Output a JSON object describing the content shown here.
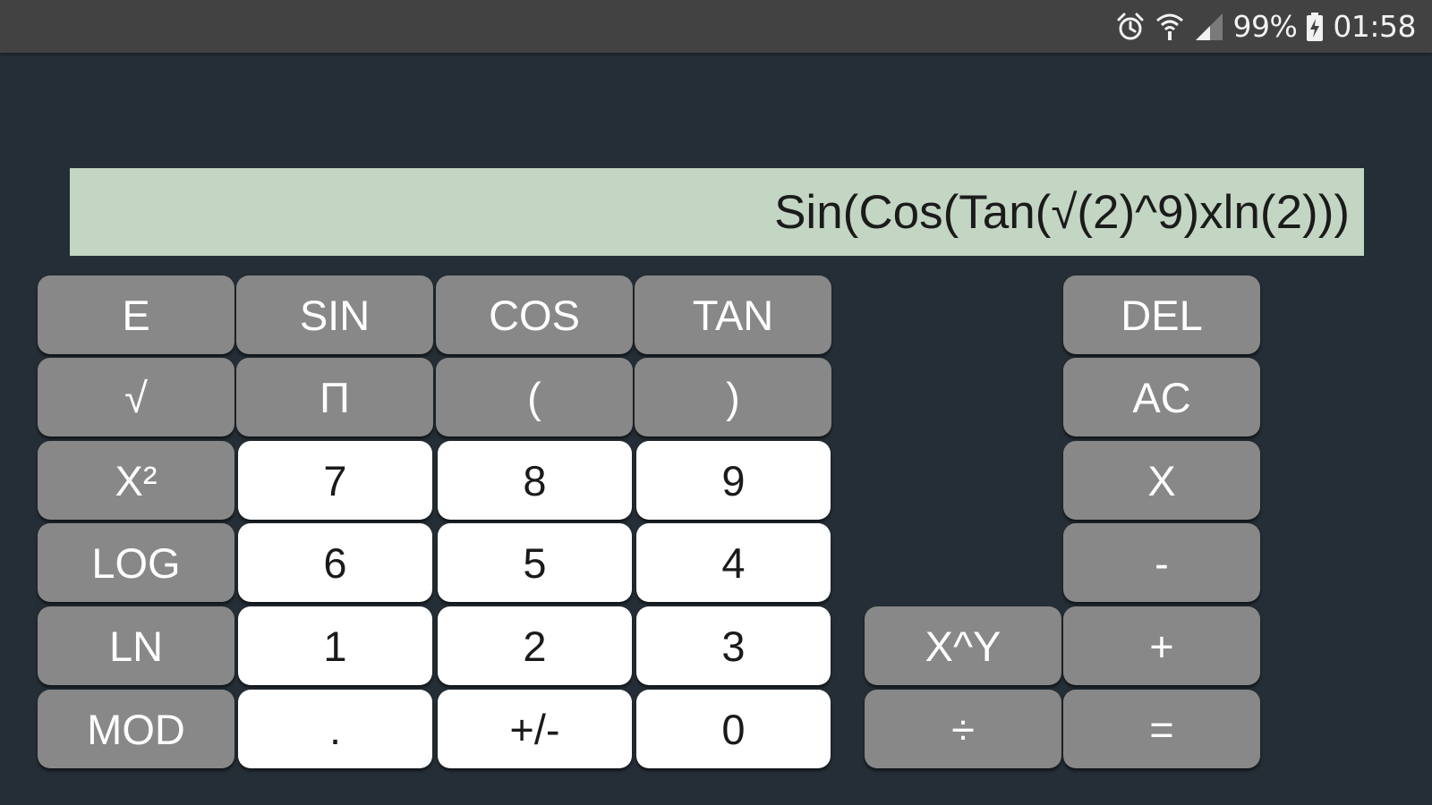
{
  "status_bar": {
    "battery": "99%",
    "time": "01:58",
    "icons": [
      "alarm-icon",
      "wifi-icon",
      "cell-signal-icon",
      "battery-charging-icon"
    ]
  },
  "display": {
    "expression": "Sin(Cos(Tan(√(2)^9)xln(2)))"
  },
  "keypad": {
    "e": "E",
    "sin": "SIN",
    "cos": "COS",
    "tan": "TAN",
    "sqrt": "√",
    "pi": "Π",
    "open_paren": "(",
    "close_paren": ")",
    "square": "X²",
    "log": "LOG",
    "ln": "LN",
    "mod": "MOD",
    "n7": "7",
    "n8": "8",
    "n9": "9",
    "n6": "6",
    "n5": "5",
    "n4": "4",
    "n1": "1",
    "n2": "2",
    "n3": "3",
    "decimal": ".",
    "negate": "+/-",
    "n0": "0",
    "del": "DEL",
    "ac": "AC",
    "multiply": "X",
    "minus": "-",
    "power": "X^Y",
    "plus": "+",
    "divide": "÷",
    "equals": "="
  },
  "colors": {
    "background": "#252e36",
    "status_bar": "#424242",
    "display": "#c3d5c3",
    "function_key": "#888888",
    "number_key": "#ffffff"
  }
}
